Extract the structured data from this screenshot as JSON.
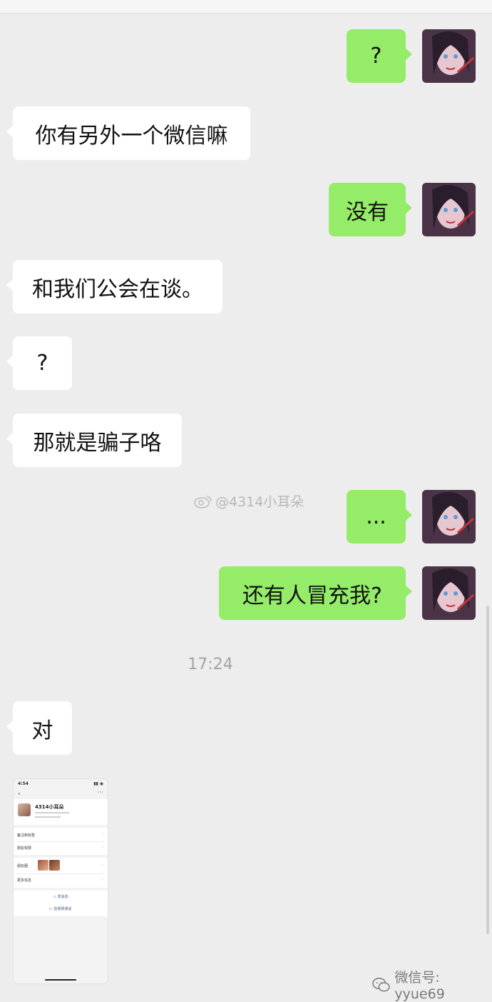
{
  "messages": [
    {
      "side": "out",
      "text": "?"
    },
    {
      "side": "in",
      "text": "你有另外一个微信嘛"
    },
    {
      "side": "out",
      "text": "没有"
    },
    {
      "side": "in",
      "text": "和我们公会在谈。"
    },
    {
      "side": "in",
      "text": "?"
    },
    {
      "side": "in",
      "text": "那就是骗子咯"
    },
    {
      "side": "out",
      "text": "..."
    },
    {
      "side": "out",
      "text": "还有人冒充我?"
    },
    {
      "side": "in",
      "text": "对"
    }
  ],
  "timestamp": "17:24",
  "watermarks": {
    "weibo": "@4314小耳朵",
    "wechat": "微信号: yyue69"
  },
  "screenshot_card": {
    "status_time": "4:54",
    "profile_name": "4314小耳朵",
    "items": [
      "备注和标签",
      "朋友权限",
      "朋友圈",
      "更多信息"
    ],
    "send_message": "发消息",
    "video_call": "音视频通话"
  },
  "colors": {
    "background": "#ededed",
    "outgoing_bubble": "#95ec69",
    "incoming_bubble": "#ffffff"
  },
  "icons": {
    "weibo": "weibo-icon",
    "wechat": "wechat-icon"
  }
}
